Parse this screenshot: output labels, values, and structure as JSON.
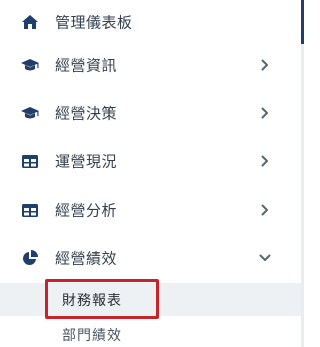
{
  "sidebar": {
    "items": [
      {
        "label": "管理儀表板",
        "icon": "home-icon",
        "has_chevron": false
      },
      {
        "label": "經營資訊",
        "icon": "graduation-cap-icon",
        "has_chevron": true,
        "chevron": "chevron-right-icon"
      },
      {
        "label": "經營決策",
        "icon": "graduation-cap-icon",
        "has_chevron": true,
        "chevron": "chevron-right-icon"
      },
      {
        "label": "運營現況",
        "icon": "table-icon",
        "has_chevron": true,
        "chevron": "chevron-right-icon"
      },
      {
        "label": "經營分析",
        "icon": "table-icon",
        "has_chevron": true,
        "chevron": "chevron-right-icon"
      },
      {
        "label": "經營績效",
        "icon": "pie-chart-icon",
        "has_chevron": true,
        "chevron": "chevron-down-icon",
        "expanded": true
      }
    ],
    "subitems": [
      {
        "label": "財務報表",
        "active": true,
        "highlighted": true
      },
      {
        "label": "部門績效",
        "active": false
      }
    ]
  },
  "colors": {
    "icon": "#1f3f6b",
    "text": "#34404f",
    "chevron": "#5a6573",
    "active_bg": "#eef1f4",
    "highlight": "#c8222a",
    "scrollbar": "#1f3f6b"
  }
}
